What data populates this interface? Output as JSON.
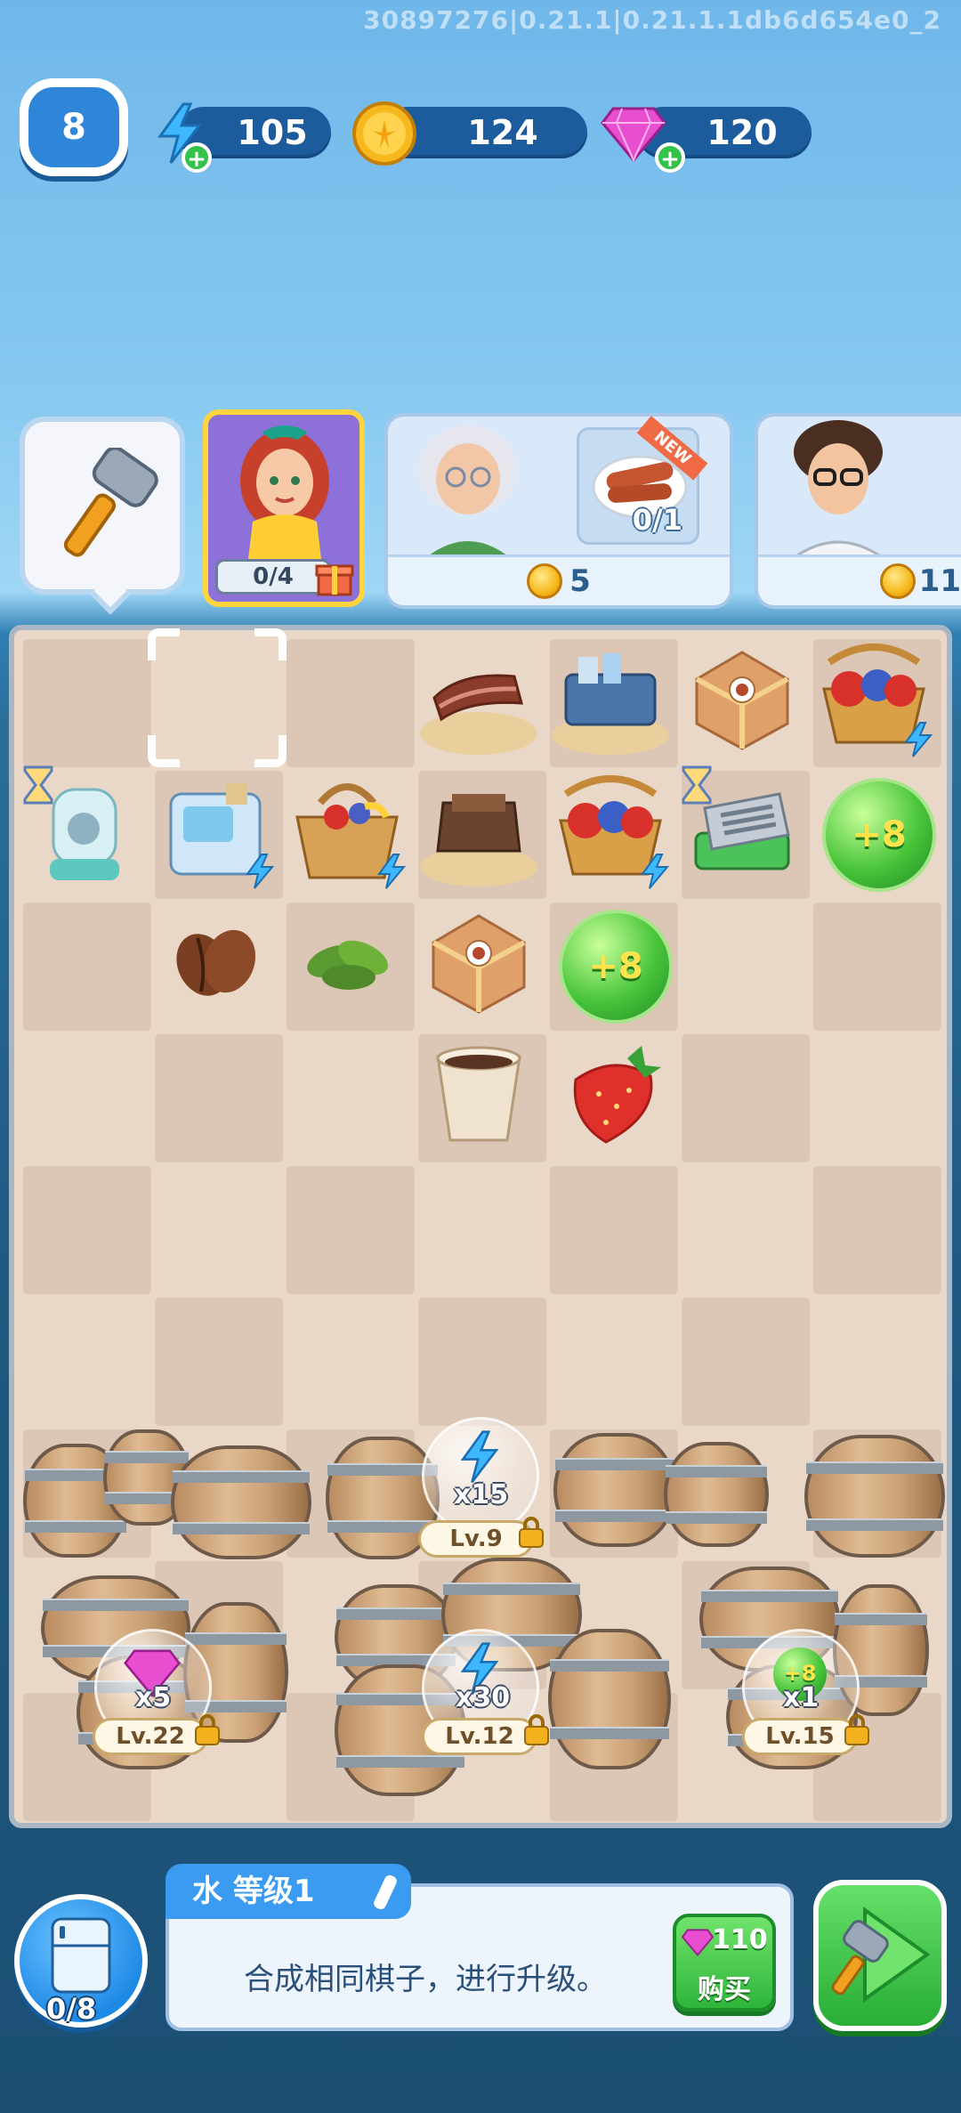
{
  "version_text": "30897276|0.21.1|0.21.1.1db6d654e0_2",
  "hud": {
    "player_level": "8",
    "energy": "105",
    "coins": "124",
    "gems": "120"
  },
  "customers": {
    "main_progress": "0/4",
    "order_progress": "0/1",
    "order_tag": "NEW",
    "order_reward": "5",
    "next_reward": "11"
  },
  "board_bubbles": [
    "+8",
    "+8"
  ],
  "locked_rewards": [
    {
      "mult": "x15",
      "level": "Lv.9"
    },
    {
      "mult": "x5",
      "level": "Lv.22"
    },
    {
      "mult": "x30",
      "level": "Lv.12"
    },
    {
      "mult": "x1",
      "level": "Lv.15"
    }
  ],
  "locked_bubble_small": "+8",
  "info": {
    "title": "水  等级1",
    "description": "合成相同棋子，进行升级。",
    "buy_price": "110",
    "buy_label": "购买"
  },
  "storage_count": "0/8",
  "colors": {
    "accent_blue": "#3a9bf0",
    "coin_gold": "#f6b81c",
    "gem_pink": "#e84fd0",
    "button_green": "#2fb53b"
  }
}
